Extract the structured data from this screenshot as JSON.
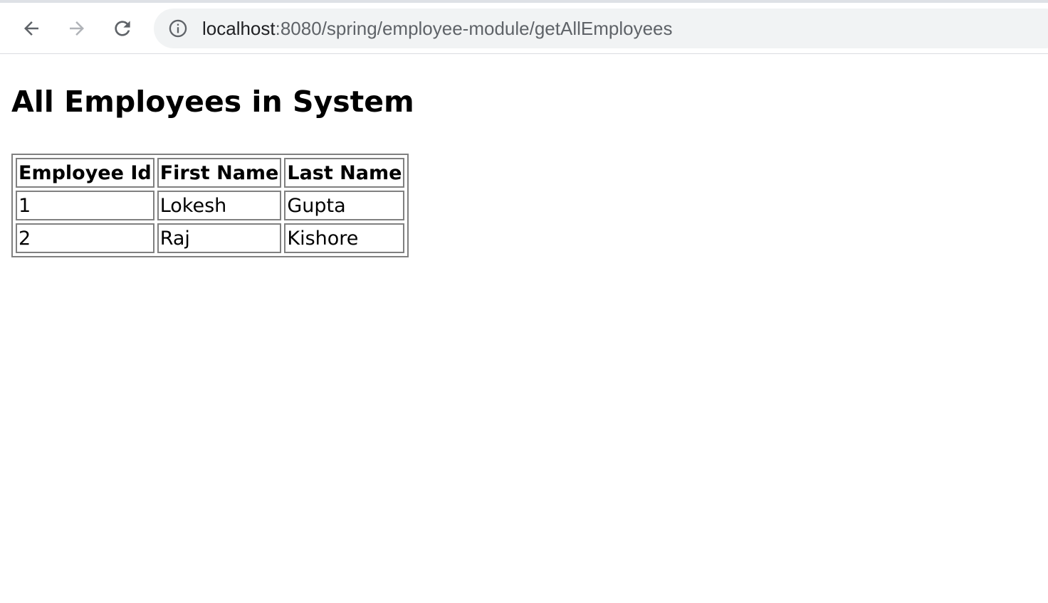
{
  "browser": {
    "url_host": "localhost",
    "url_path": ":8080/spring/employee-module/getAllEmployees",
    "icons": {
      "back": "back-arrow-icon",
      "forward": "forward-arrow-icon",
      "reload": "reload-icon",
      "site_info": "info-icon"
    }
  },
  "page": {
    "title": "All Employees in System",
    "table": {
      "headers": [
        "Employee Id",
        "First Name",
        "Last Name"
      ],
      "rows": [
        [
          "1",
          "Lokesh",
          "Gupta"
        ],
        [
          "2",
          "Raj",
          "Kishore"
        ]
      ]
    }
  }
}
